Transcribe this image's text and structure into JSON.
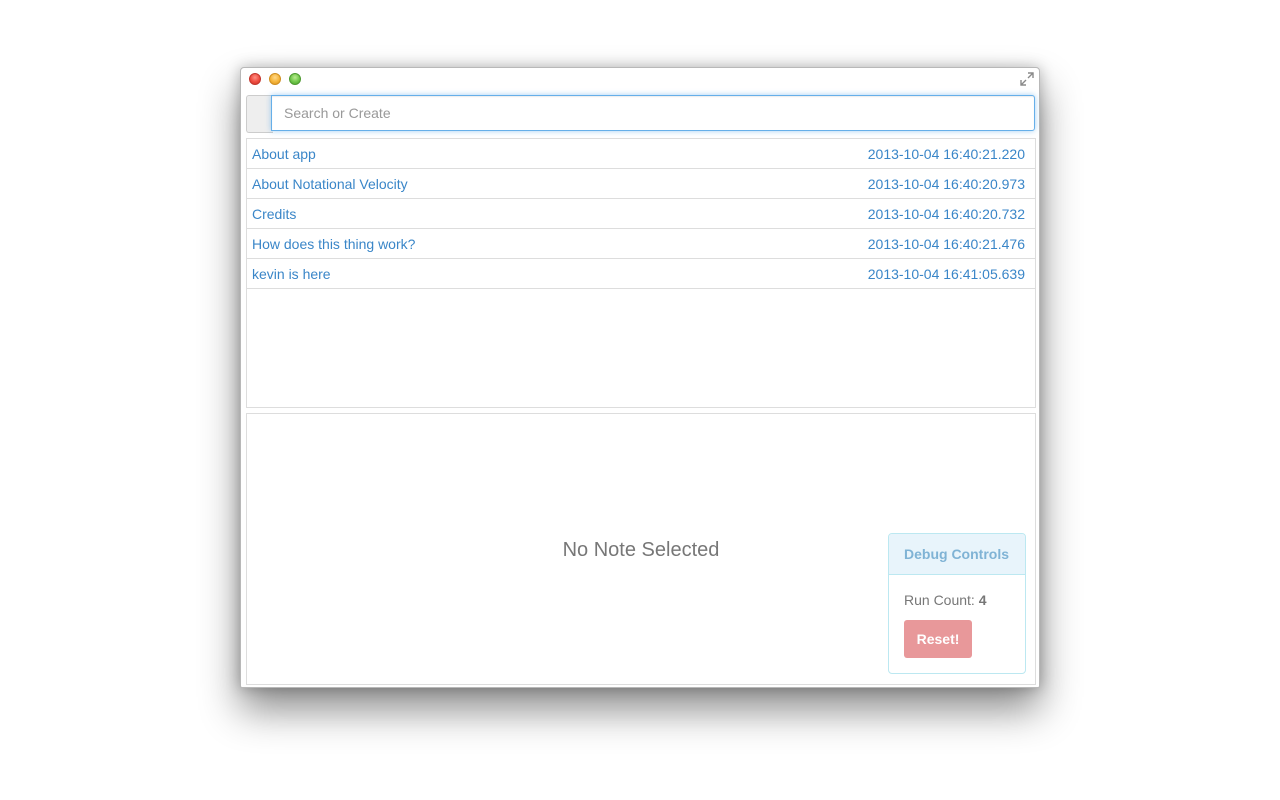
{
  "window": {
    "controls": [
      "close",
      "minimize",
      "zoom"
    ],
    "fullscreen_icon": "fullscreen-arrows-icon"
  },
  "search": {
    "placeholder": "Search or Create",
    "value": ""
  },
  "notes": [
    {
      "title": "About app",
      "date": "2013-10-04 16:40:21.220"
    },
    {
      "title": "About Notational Velocity",
      "date": "2013-10-04 16:40:20.973"
    },
    {
      "title": "Credits",
      "date": "2013-10-04 16:40:20.732"
    },
    {
      "title": "How does this thing work?",
      "date": "2013-10-04 16:40:21.476"
    },
    {
      "title": "kevin is here",
      "date": "2013-10-04 16:41:05.639"
    }
  ],
  "editor": {
    "empty_message": "No Note Selected"
  },
  "debug": {
    "title": "Debug Controls",
    "run_count_label": "Run Count:",
    "run_count_value": "4",
    "reset_label": "Reset!"
  },
  "colors": {
    "link": "#3a86c8",
    "focus": "#66afe9",
    "debug_heading_bg": "#e8f4fb",
    "debug_heading_text": "#7fb3d5",
    "reset_bg": "#e8989a"
  }
}
